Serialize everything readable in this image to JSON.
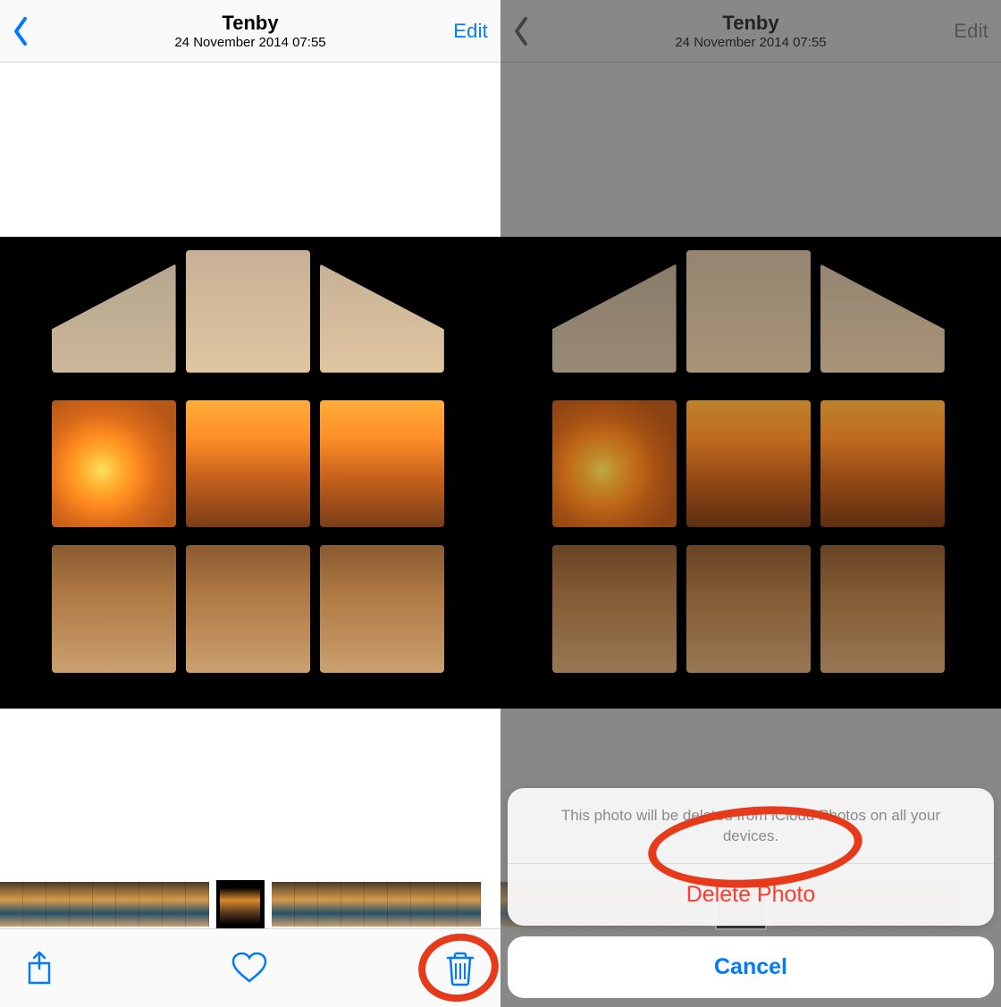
{
  "left": {
    "nav": {
      "title": "Tenby",
      "subtitle": "24 November 2014  07:55",
      "edit": "Edit"
    }
  },
  "right": {
    "nav": {
      "title": "Tenby",
      "subtitle": "24 November 2014  07:55",
      "edit": "Edit"
    },
    "sheet": {
      "message": "This photo will be deleted from iCloud Photos on all your devices.",
      "delete": "Delete Photo",
      "cancel": "Cancel"
    }
  },
  "colors": {
    "accent": "#007aff",
    "destructive": "#ff3b30",
    "annotation": "#e63a1a"
  }
}
